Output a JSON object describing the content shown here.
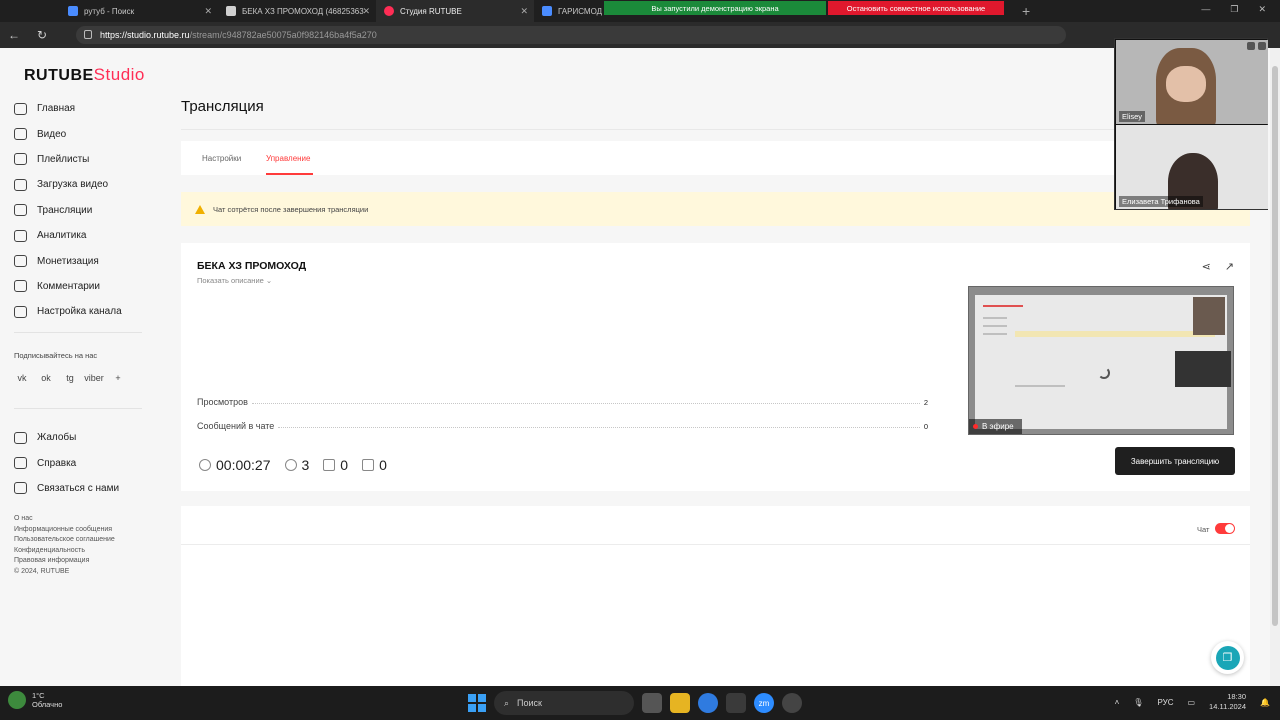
{
  "browser": {
    "tabs": [
      {
        "title": "рутуб - Поиск",
        "icon_color": "#4a8cff",
        "active": false
      },
      {
        "title": "БЕКА ХЗ ПРОМОХОД (46825363",
        "icon_color": "#cfcfcf",
        "active": false
      },
      {
        "title": "Студия RUTUBE",
        "icon_color": "#ff2d55",
        "active": true
      },
      {
        "title": "ГАРИСМОД",
        "icon_color": "#4a8cff",
        "active": false
      }
    ],
    "share_notice": "Вы запустили демонстрацию экрана",
    "stop_share": "Остановить совместное использование",
    "url_domain": "https://studio.rutube.ru",
    "url_path": "/stream/c948782ae50075a0f982146ba4f5a270"
  },
  "logo": {
    "main": "RUTUBE",
    "sub": "Studio"
  },
  "sidebar": {
    "items": [
      {
        "label": "Главная",
        "icon": "home-icon"
      },
      {
        "label": "Видео",
        "icon": "video-icon"
      },
      {
        "label": "Плейлисты",
        "icon": "playlist-icon"
      },
      {
        "label": "Загрузка видео",
        "icon": "upload-icon"
      },
      {
        "label": "Трансляции",
        "icon": "broadcast-icon"
      },
      {
        "label": "Аналитика",
        "icon": "analytics-icon"
      },
      {
        "label": "Монетизация",
        "icon": "monetization-icon"
      },
      {
        "label": "Комментарии",
        "icon": "comments-icon"
      },
      {
        "label": "Настройка канала",
        "icon": "channel-settings-icon"
      }
    ],
    "subscribe": "Подписывайтесь на нас",
    "socials": [
      "vk",
      "ok",
      "tg",
      "viber",
      "+"
    ],
    "support": [
      {
        "label": "Жалобы",
        "icon": "flag-icon"
      },
      {
        "label": "Справка",
        "icon": "help-icon"
      },
      {
        "label": "Связаться с нами",
        "icon": "mail-icon"
      }
    ],
    "legal": [
      "О нас",
      "Информационные сообщения",
      "Пользовательское соглашение",
      "Конфиденциальность",
      "Правовая информация",
      "© 2024, RUTUBE"
    ]
  },
  "page": {
    "title": "Трансляция",
    "tabs": [
      "Настройки",
      "Управление"
    ],
    "active_tab": "Управление",
    "warning": "Чат сотрётся после завершения трансляции"
  },
  "stream": {
    "title": "БЕКА ХЗ ПРОМОХОД",
    "show_description": "Показать описание",
    "stats": [
      {
        "label": "Просмотров",
        "value": "2"
      },
      {
        "label": "Сообщений в чате",
        "value": "0"
      }
    ],
    "duration": "00:00:27",
    "viewers": "3",
    "likes": "0",
    "dislikes": "0",
    "on_air": "В эфире",
    "end_button": "Завершить трансляцию"
  },
  "chat": {
    "label": "Чат",
    "enabled": true
  },
  "call": {
    "participants": [
      "Elisey",
      "Елизавета Трифанова"
    ]
  },
  "taskbar": {
    "temp": "1°C",
    "weather": "Облачно",
    "search": "Поиск",
    "lang": "РУС",
    "time": "18:30",
    "date": "14.11.2024"
  }
}
